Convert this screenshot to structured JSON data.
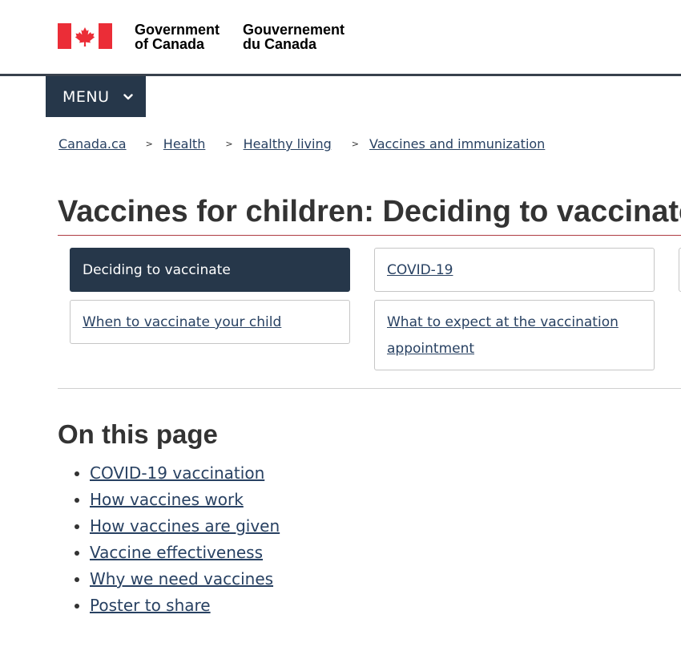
{
  "header": {
    "flag_icon": "canada-flag-icon",
    "signature_en": [
      "Government",
      "of Canada"
    ],
    "signature_fr": [
      "Gouvernement",
      "du Canada"
    ],
    "accent_color": "#eb2d37",
    "rule_color": "#38414d"
  },
  "menu": {
    "label": "MENU",
    "icon": "chevron-down-icon",
    "bg_color": "#26374a"
  },
  "breadcrumb": {
    "items": [
      "Canada.ca",
      "Health",
      "Healthy living",
      "Vaccines and immunization"
    ],
    "separator": ">"
  },
  "page": {
    "title": "Vaccines for children: Deciding to vaccinate",
    "title_rule_color": "#af3c43"
  },
  "subnav": {
    "items": [
      {
        "label": "Deciding to vaccinate",
        "active": true
      },
      {
        "label": "COVID-19",
        "active": false
      },
      {
        "label": "When to vaccinate your child",
        "active": false
      },
      {
        "label": "What to expect at the vaccination appointment",
        "active": false
      }
    ]
  },
  "on_this_page": {
    "heading": "On this page",
    "links": [
      "COVID-19 vaccination",
      "How vaccines work",
      "How vaccines are given",
      "Vaccine effectiveness",
      "Why we need vaccines",
      "Poster to share"
    ],
    "link_color": "#284162"
  }
}
